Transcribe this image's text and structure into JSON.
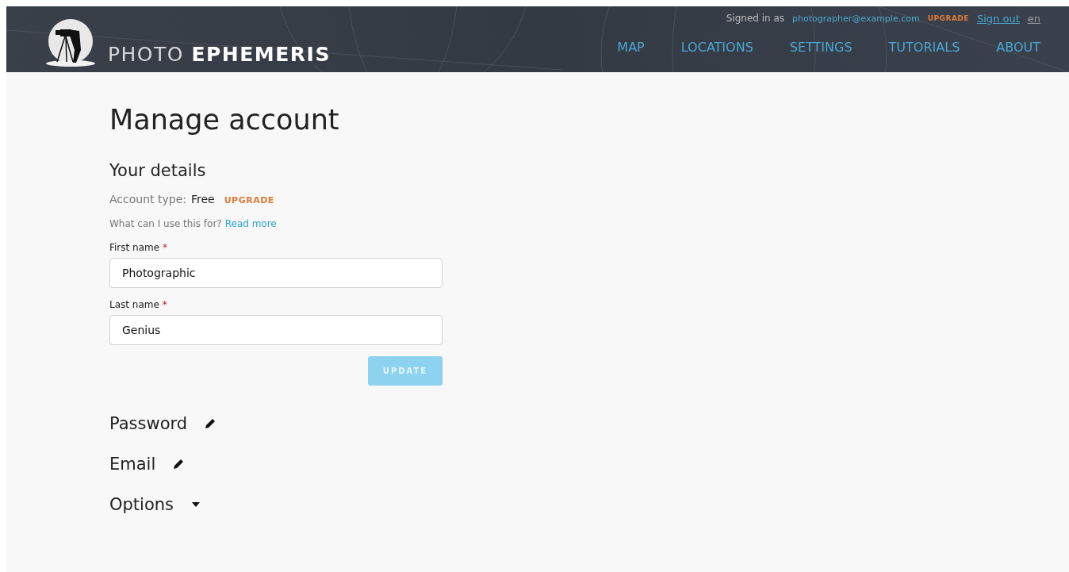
{
  "header": {
    "brand_light": "PHOTO",
    "brand_bold": "EPHEMERIS",
    "signed_in_label": "Signed in as",
    "email": "photographer@example.com",
    "upgrade": "UPGRADE",
    "sign_out": "Sign out",
    "language": "en",
    "nav": [
      {
        "label": "MAP"
      },
      {
        "label": "LOCATIONS"
      },
      {
        "label": "SETTINGS"
      },
      {
        "label": "TUTORIALS"
      },
      {
        "label": "ABOUT"
      }
    ]
  },
  "page_title": "Manage account",
  "details": {
    "title": "Your details",
    "account_type_label": "Account type:",
    "account_type": "Free",
    "upgrade": "UPGRADE",
    "help_text": "What can I use this for?",
    "help_link": "Read more",
    "fields": [
      {
        "label": "First name",
        "required_mark": "*",
        "value": "Photographic"
      },
      {
        "label": "Last name",
        "required_mark": "*",
        "value": "Genius"
      }
    ],
    "update_button": {
      "label": "UPDATE",
      "disabled": true
    }
  },
  "sections": [
    {
      "title": "Password",
      "kind": "edit"
    },
    {
      "title": "Email",
      "kind": "edit"
    },
    {
      "title": "Options",
      "kind": "toggle",
      "expanded": false
    }
  ]
}
